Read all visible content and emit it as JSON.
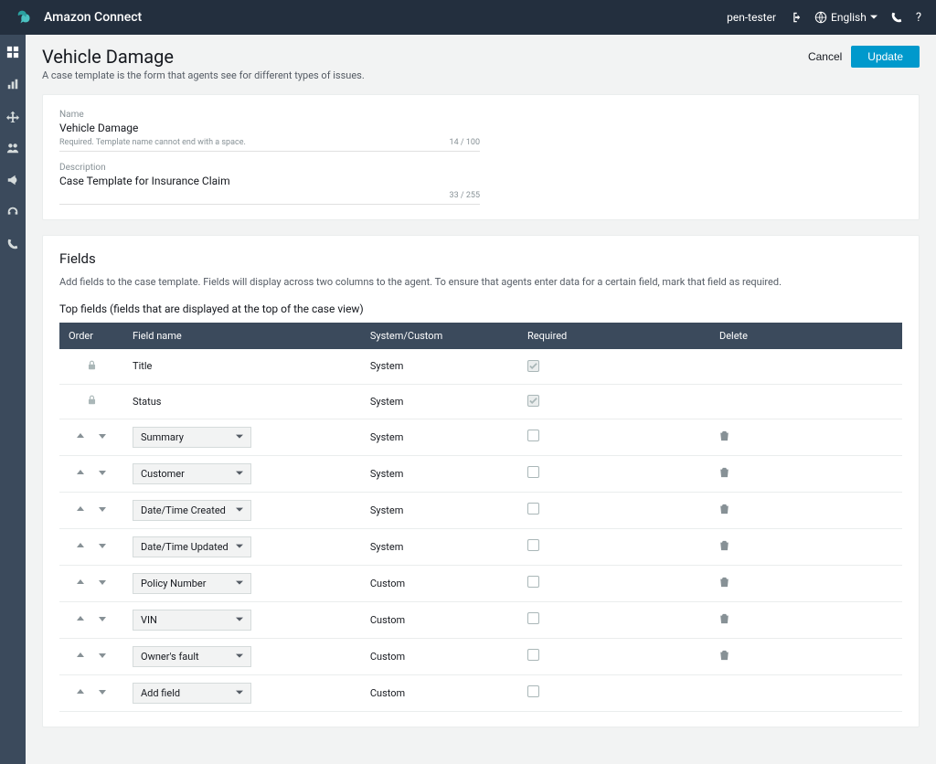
{
  "topbar": {
    "product": "Amazon Connect",
    "user": "pen-tester",
    "language": "English"
  },
  "page": {
    "title": "Vehicle Damage",
    "subtitle": "A case template is the form that agents see for different types of issues.",
    "cancel": "Cancel",
    "update": "Update"
  },
  "name_field": {
    "label": "Name",
    "value": "Vehicle Damage",
    "hint": "Required.  Template name cannot end with a space.",
    "counter": "14 / 100"
  },
  "desc_field": {
    "label": "Description",
    "value": "Case Template for Insurance Claim",
    "counter": "33 / 255"
  },
  "fields_section": {
    "title": "Fields",
    "desc": "Add fields to the case template. Fields will display across two columns to the agent. To ensure that agents enter data for a certain field, mark that field as required.",
    "subtitle": "Top fields (fields that are displayed at the top of the case view)"
  },
  "columns": {
    "order": "Order",
    "field_name": "Field name",
    "system_custom": "System/Custom",
    "required": "Required",
    "delete": "Delete"
  },
  "rows": [
    {
      "locked": true,
      "name": "Title",
      "type": "System",
      "required_locked": true,
      "deletable": false
    },
    {
      "locked": true,
      "name": "Status",
      "type": "System",
      "required_locked": true,
      "deletable": false
    },
    {
      "locked": false,
      "name": "Summary",
      "type": "System",
      "required_locked": false,
      "deletable": true
    },
    {
      "locked": false,
      "name": "Customer",
      "type": "System",
      "required_locked": false,
      "deletable": true
    },
    {
      "locked": false,
      "name": "Date/Time Created",
      "type": "System",
      "required_locked": false,
      "deletable": true
    },
    {
      "locked": false,
      "name": "Date/Time Updated",
      "type": "System",
      "required_locked": false,
      "deletable": true
    },
    {
      "locked": false,
      "name": "Policy Number",
      "type": "Custom",
      "required_locked": false,
      "deletable": true
    },
    {
      "locked": false,
      "name": "VIN",
      "type": "Custom",
      "required_locked": false,
      "deletable": true
    },
    {
      "locked": false,
      "name": "Owner's fault",
      "type": "Custom",
      "required_locked": false,
      "deletable": true
    },
    {
      "locked": false,
      "name": "Add field",
      "type": "Custom",
      "required_locked": false,
      "deletable": false,
      "add_row": true
    }
  ]
}
